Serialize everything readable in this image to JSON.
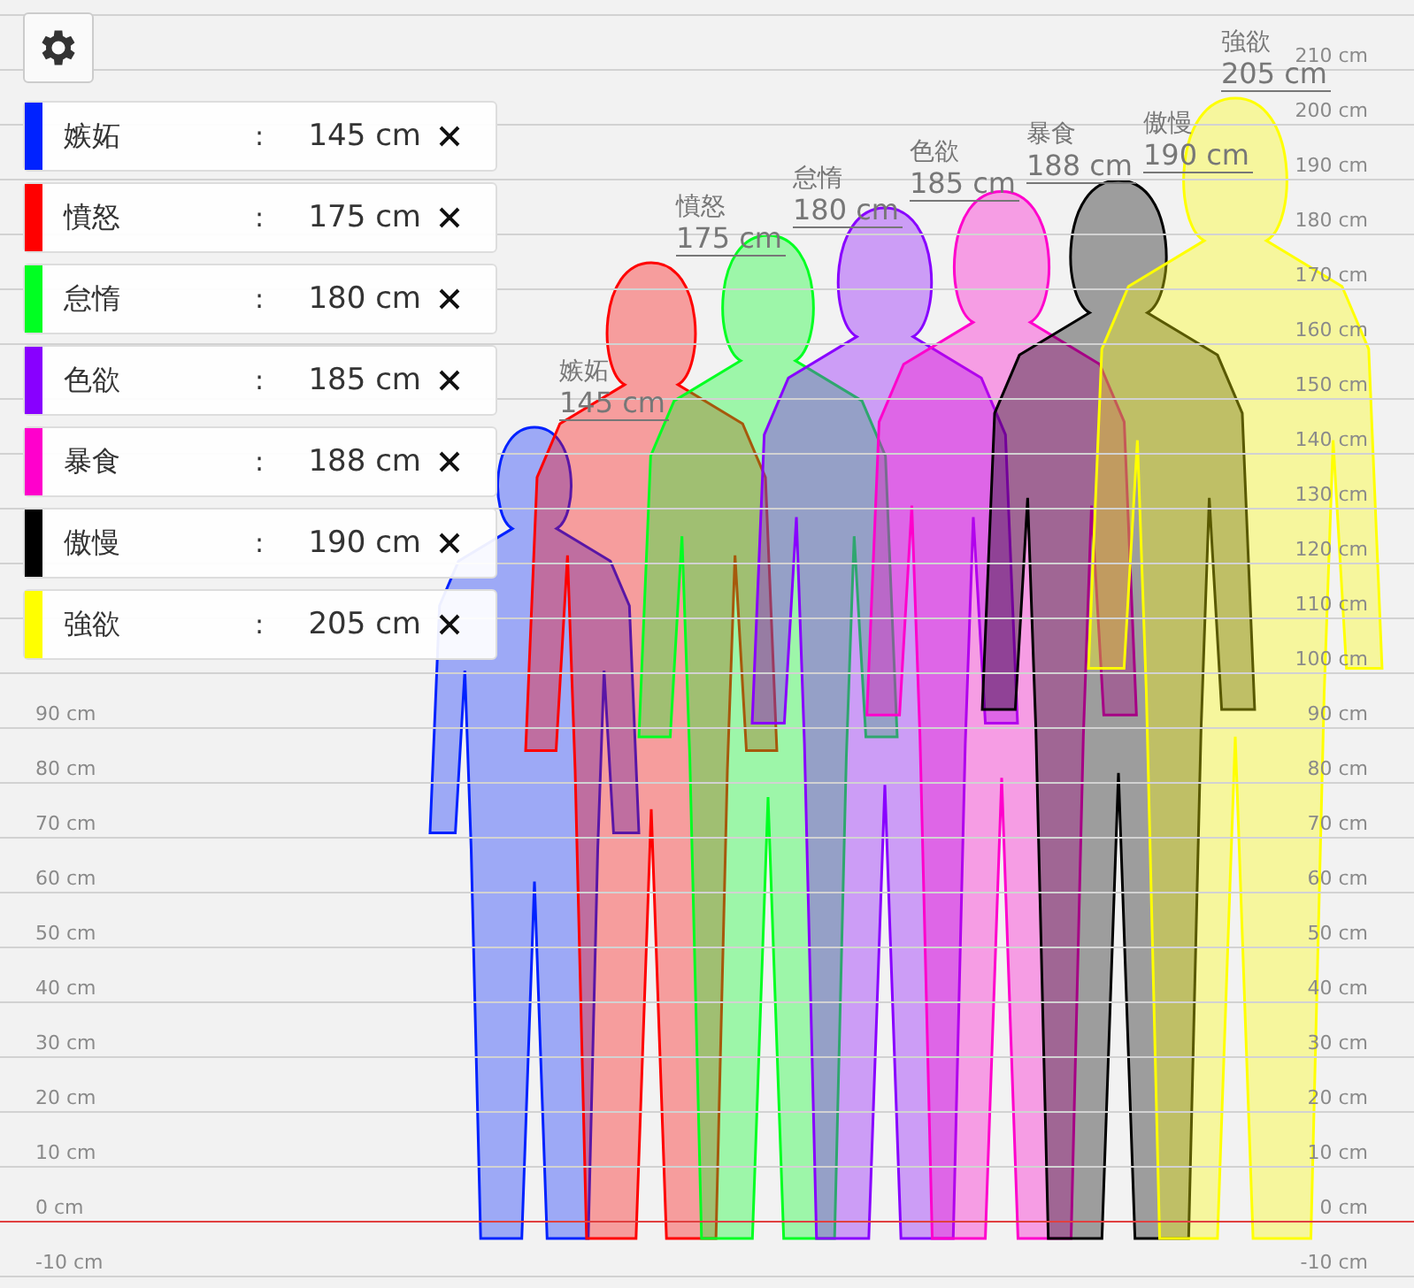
{
  "scale": {
    "right_labels": [
      "210 cm",
      "200 cm",
      "190 cm",
      "180 cm",
      "170 cm",
      "160 cm",
      "150 cm",
      "140 cm",
      "130 cm",
      "120 cm",
      "110 cm",
      "100 cm",
      "90 cm",
      "80 cm",
      "70 cm",
      "60 cm",
      "50 cm",
      "40 cm",
      "30 cm",
      "20 cm",
      "10 cm",
      "0 cm",
      "-10 cm"
    ],
    "left_labels": [
      "90 cm",
      "80 cm",
      "70 cm",
      "60 cm",
      "50 cm",
      "40 cm",
      "30 cm",
      "20 cm",
      "10 cm",
      "0 cm",
      "-10 cm"
    ]
  },
  "entries": [
    {
      "name": "嫉妬",
      "separator": ":",
      "height": "145 cm",
      "color": "#0022ff"
    },
    {
      "name": "憤怒",
      "separator": ":",
      "height": "175 cm",
      "color": "#ff0000"
    },
    {
      "name": "怠惰",
      "separator": ":",
      "height": "180 cm",
      "color": "#00ff22"
    },
    {
      "name": "色欲",
      "separator": ":",
      "height": "185 cm",
      "color": "#8800ff"
    },
    {
      "name": "暴食",
      "separator": ":",
      "height": "188 cm",
      "color": "#ff00cc"
    },
    {
      "name": "傲慢",
      "separator": ":",
      "height": "190 cm",
      "color": "#000000"
    },
    {
      "name": "強欲",
      "separator": ":",
      "height": "205 cm",
      "color": "#ffff00"
    }
  ],
  "figures": [
    {
      "name": "嫉妬",
      "height": "145 cm",
      "color": "#0022ff"
    },
    {
      "name": "憤怒",
      "height": "175 cm",
      "color": "#ff0000"
    },
    {
      "name": "怠惰",
      "height": "180 cm",
      "color": "#00ff22"
    },
    {
      "name": "色欲",
      "height": "185 cm",
      "color": "#8800ff"
    },
    {
      "name": "暴食",
      "height": "188 cm",
      "color": "#ff00cc"
    },
    {
      "name": "傲慢",
      "height": "190 cm",
      "color": "#000000"
    },
    {
      "name": "強欲",
      "height": "205 cm",
      "color": "#ffff00"
    }
  ]
}
